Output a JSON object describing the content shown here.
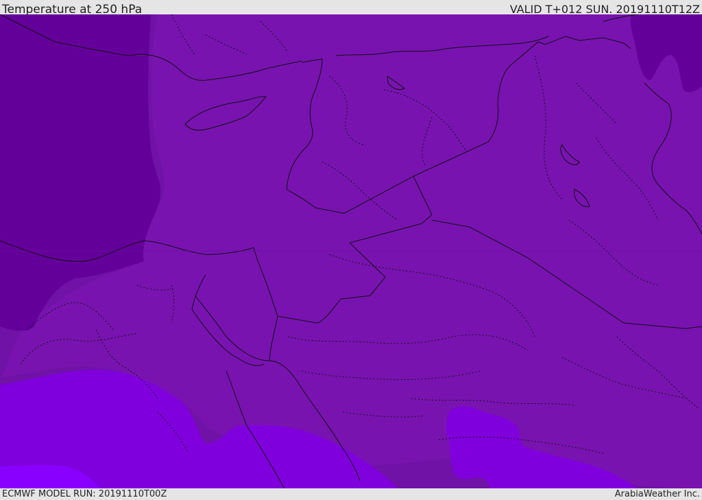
{
  "header": {
    "title": "Temperature at 250 hPa",
    "valid": "VALID T+012 SUN. 20191110T12Z"
  },
  "footer": {
    "model_run": "ECMWF MODEL RUN: 20191110T00Z",
    "credit": "ArabiaWeather Inc."
  },
  "colors": {
    "band_coldest": "#64009a",
    "band_main": "#7813b0",
    "band_mid": "#7012a6",
    "band_warm": "#8000dd",
    "band_warmest": "#8a00ff",
    "borders": "#111111",
    "frame": "#e5e5e5"
  }
}
